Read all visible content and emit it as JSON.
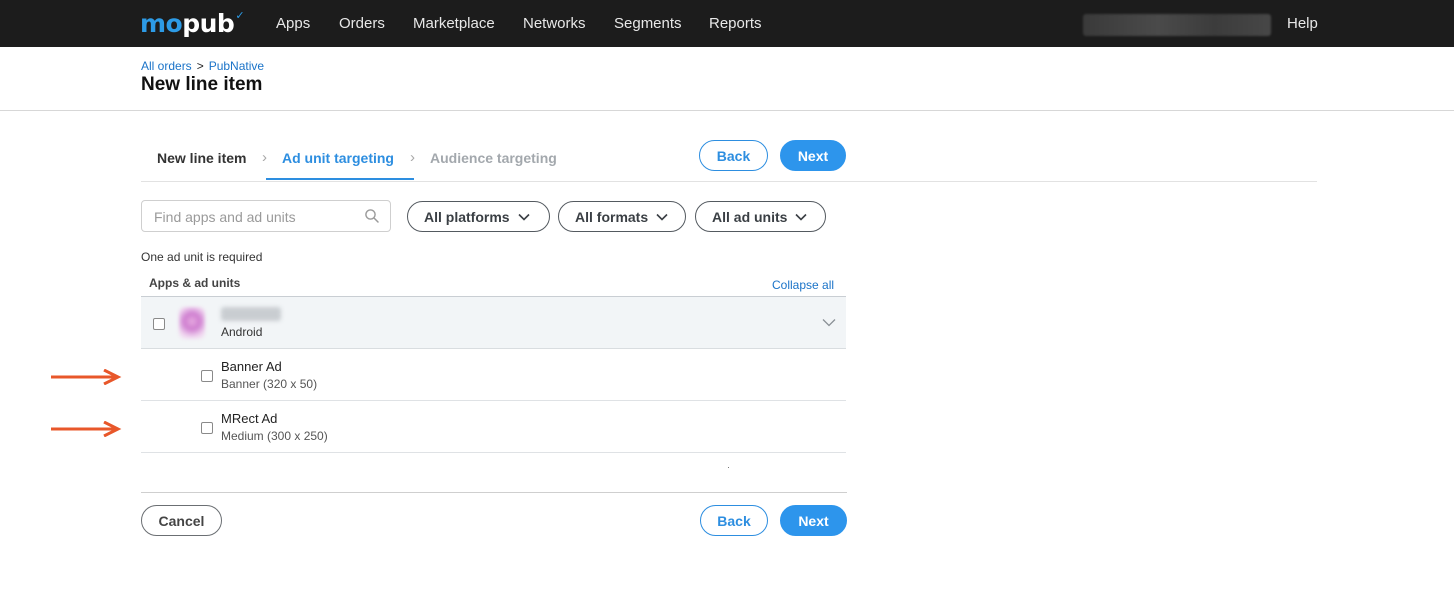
{
  "topnav": {
    "logo": {
      "part1": "mo",
      "part2": "pub"
    },
    "items": [
      {
        "label": "Apps"
      },
      {
        "label": "Orders"
      },
      {
        "label": "Marketplace"
      },
      {
        "label": "Networks"
      },
      {
        "label": "Segments"
      },
      {
        "label": "Reports"
      }
    ],
    "help_label": "Help"
  },
  "breadcrumb": {
    "items": [
      {
        "label": "All orders"
      },
      {
        "label": "PubNative"
      }
    ],
    "separator": ">"
  },
  "page_title": "New line item",
  "stepper": {
    "steps": [
      {
        "label": "New line item",
        "state": "done"
      },
      {
        "label": "Ad unit targeting",
        "state": "active"
      },
      {
        "label": "Audience targeting",
        "state": "upcoming"
      }
    ],
    "back_label": "Back",
    "next_label": "Next"
  },
  "search": {
    "placeholder": "Find apps and ad units",
    "icon": "search-icon"
  },
  "filters": [
    {
      "label": "All platforms"
    },
    {
      "label": "All formats"
    },
    {
      "label": "All ad units"
    }
  ],
  "required_note": "One ad unit is required",
  "table": {
    "header_label": "Apps & ad units",
    "collapse_all_label": "Collapse all",
    "app": {
      "platform": "Android",
      "checked": false
    },
    "ad_units": [
      {
        "name": "Banner Ad",
        "size": "Banner (320 x 50)",
        "checked": false
      },
      {
        "name": "MRect Ad",
        "size": "Medium (300 x 250)",
        "checked": false
      }
    ]
  },
  "footer": {
    "cancel_label": "Cancel",
    "back_label": "Back",
    "next_label": "Next"
  },
  "colors": {
    "accent": "#2d95ec",
    "link": "#1a73c8",
    "nav_bg": "#1c1c1c",
    "annotation_arrow": "#e8572a"
  }
}
